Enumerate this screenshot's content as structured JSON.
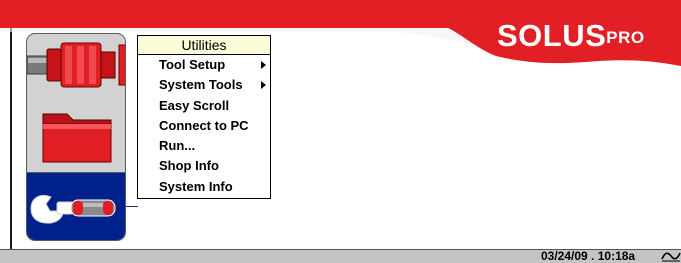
{
  "brand": {
    "name": "SOLUS",
    "suffix": "PRO"
  },
  "colors": {
    "banner_red": "#e11f24",
    "panel_gray": "#d2d2d2",
    "selected_blue": "#00208c",
    "menu_title_bg": "#fcfcd8"
  },
  "icons": [
    "vehicle-connector-icon",
    "folder-icon",
    "wrench-icon"
  ],
  "menu": {
    "title": "Utilities",
    "items": [
      {
        "label": "Tool Setup",
        "submenu": true
      },
      {
        "label": "System Tools",
        "submenu": true
      },
      {
        "label": "Easy Scroll",
        "submenu": false
      },
      {
        "label": "Connect to PC",
        "submenu": false
      },
      {
        "label": "Run...",
        "submenu": false
      },
      {
        "label": "Shop Info",
        "submenu": false
      },
      {
        "label": "System Info",
        "submenu": false
      }
    ]
  },
  "status": {
    "date": "03/24/09",
    "time": "10:18a"
  }
}
